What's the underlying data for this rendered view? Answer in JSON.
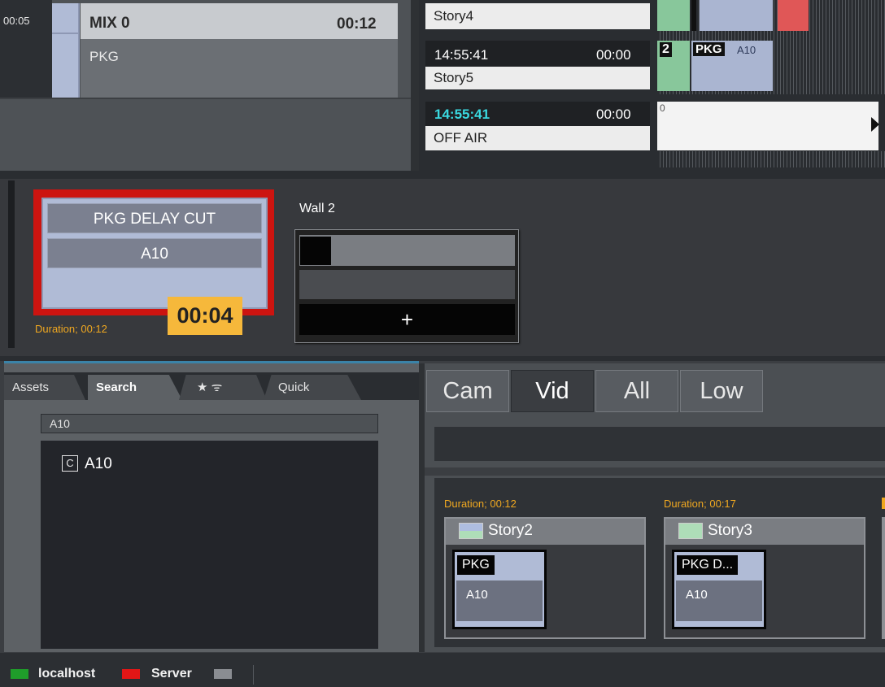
{
  "mix": {
    "clock": "00:05",
    "title": "MIX 0",
    "duration": "00:12",
    "subtitle": "PKG"
  },
  "rundown": {
    "rows": [
      {
        "name": "Story4"
      },
      {
        "time": "14:55:41",
        "duration": "00:00",
        "name": "Story5"
      },
      {
        "time": "14:55:41",
        "duration": "00:00",
        "name": "OFF AIR"
      }
    ],
    "clips": {
      "row5_number": "2",
      "row5_label": "PKG",
      "row5_id": "A10",
      "row6_number": "0"
    }
  },
  "preview": {
    "cue_name": "PKG DELAY CUT",
    "cue_id": "A10",
    "cue_duration": "Duration; 00:12",
    "cue_timer": "00:04",
    "wall_title": "Wall 2",
    "wall_add": "+"
  },
  "assets": {
    "tabs": [
      "Assets",
      "Search",
      "★ ᯤ",
      "Quick"
    ],
    "active_tab": "Search",
    "search_value": "A10",
    "results": [
      {
        "icon": "C",
        "label": "A10"
      }
    ]
  },
  "bins": {
    "buttons": [
      "Cam",
      "Vid",
      "All",
      "Low"
    ],
    "active": "Vid",
    "stories": [
      {
        "duration": "Duration; 00:12",
        "name": "Story2",
        "clip_label": "PKG",
        "clip_id": "A10"
      },
      {
        "duration": "Duration; 00:17",
        "name": "Story3",
        "clip_label": "PKG D...",
        "clip_id": "A10"
      }
    ]
  },
  "status": {
    "items": [
      {
        "label": "localhost",
        "color": "#1f9d2a"
      },
      {
        "label": "Server",
        "color": "#e21616"
      },
      {
        "label": "",
        "color": "#8a8d92"
      }
    ]
  },
  "colors": {
    "accent_orange": "#f0a820",
    "onair_red": "#cc1410",
    "clip_blue": "#b0bbd6",
    "clip_green": "#88c79b",
    "time_cyan": "#3ad9e0"
  }
}
